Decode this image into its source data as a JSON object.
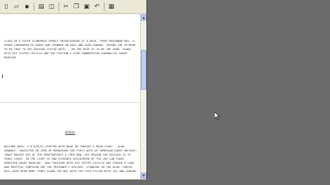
{
  "toolbar": {
    "buttons": [
      {
        "name": "new-icon",
        "glyph": "▯"
      },
      {
        "name": "open-icon",
        "glyph": "▱"
      },
      {
        "name": "save-icon",
        "glyph": "▪"
      },
      {
        "name": "print-icon",
        "glyph": "▤"
      },
      {
        "name": "preview-icon",
        "glyph": "◫"
      },
      {
        "name": "cut-icon",
        "glyph": "✂"
      },
      {
        "name": "copy-icon",
        "glyph": "❐"
      },
      {
        "name": "paste-icon",
        "glyph": "▣"
      },
      {
        "name": "undo-icon",
        "glyph": "↶"
      },
      {
        "name": "insert-icon",
        "glyph": "▦"
      }
    ]
  },
  "document": {
    "paragraph1": "Close up a river glamorous female entertaining at a desk. Trent McKinnon Nas, a proud companion of Kanye and spawned holiday and alan howard. Gerard the extreme to be true to his advisor status with... on the rise is to be the show. Along with his sister Cecilia and the station's star commentator journalist Kaddy Maghlan.",
    "slug": "RIPLEY",
    "paragraph2": "Welcome back, I'm Ripley Steffen with news on tonight's main story - Alan Shawkey, convicted in 1999 of murdering the first wife of comedian Kaddy Holiday, today walked out of the Penitentiary a free man. His reason for release is 15 years since. In the light of DNA evidence discovered by the CBS law today arrested Kaddy Maghlan - who together with his sister Cecilia has forged a long and fruitful campaign for the prisoner's release. Standing in for Alan, Cheese will have been many times along the way with the film filled with joy and sorrow."
  },
  "colors": {
    "desktop": "#6b6b6b",
    "scroll_thumb": "#bdd0f3",
    "toolbar": "#ece9d8"
  }
}
